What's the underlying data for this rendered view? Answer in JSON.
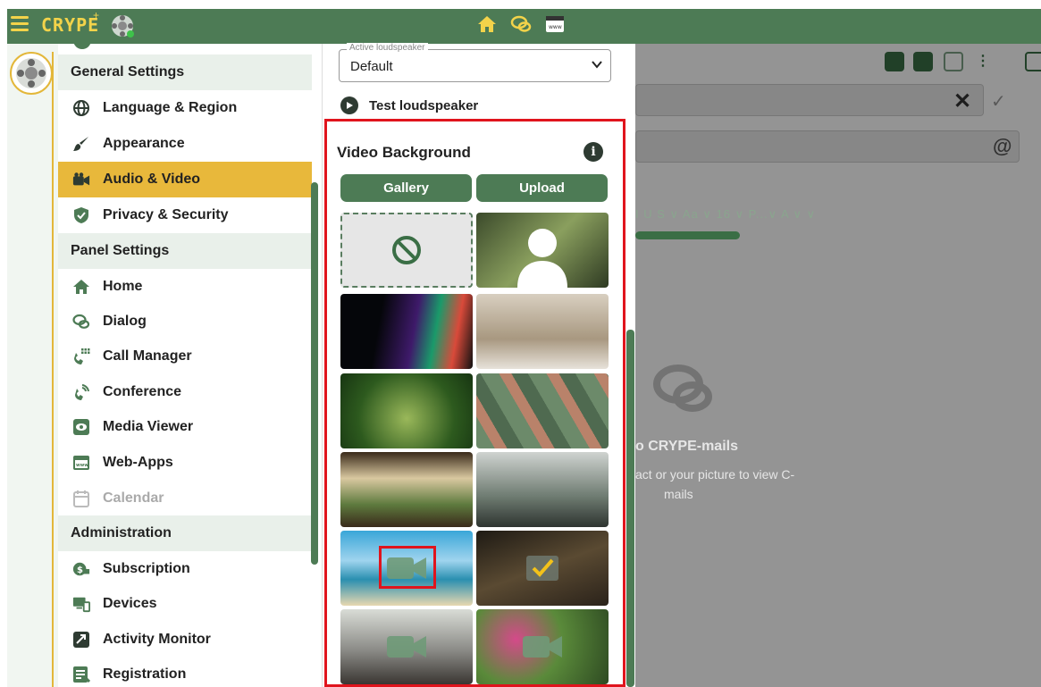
{
  "app": {
    "brand": "CRYPE",
    "brand_mark": "+"
  },
  "sidebar": {
    "sections": [
      {
        "label": "General Settings"
      },
      {
        "label": "Panel Settings"
      },
      {
        "label": "Administration"
      }
    ],
    "items": [
      {
        "label": "Language & Region"
      },
      {
        "label": "Appearance"
      },
      {
        "label": "Audio & Video"
      },
      {
        "label": "Privacy & Security"
      },
      {
        "label": "Home"
      },
      {
        "label": "Dialog"
      },
      {
        "label": "Call Manager"
      },
      {
        "label": "Conference"
      },
      {
        "label": "Media Viewer"
      },
      {
        "label": "Web-Apps"
      },
      {
        "label": "Calendar"
      },
      {
        "label": "Subscription"
      },
      {
        "label": "Devices"
      },
      {
        "label": "Activity Monitor"
      },
      {
        "label": "Registration"
      }
    ]
  },
  "audio_video": {
    "loudspeaker_legend": "Active loudspeaker",
    "loudspeaker_value": "Default",
    "test_label": "Test loudspeaker",
    "video_background_title": "Video Background",
    "gallery_label": "Gallery",
    "upload_label": "Upload"
  },
  "background": {
    "format_bar": "I  U  S ∨ Aa ∨ 16 ∨ P...∨ A ∨ ∨",
    "empty_title": "o CRYPE-mails",
    "empty_sub1": "act or your picture to view C-",
    "empty_sub2": "mails"
  },
  "colors": {
    "primary": "#4d7b55",
    "accent": "#e8b83b",
    "highlight": "#e0141d"
  }
}
